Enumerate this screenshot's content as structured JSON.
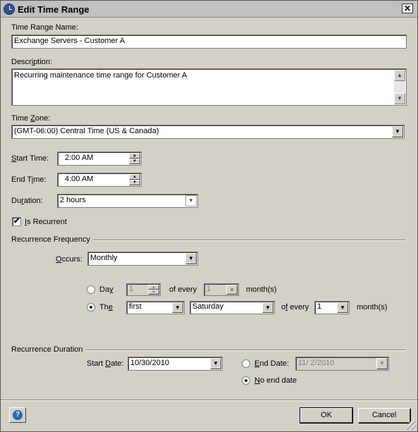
{
  "window": {
    "title": "Edit Time Range"
  },
  "name_field": {
    "label": "Time Range Name:",
    "value": "Exchange Servers - Customer A"
  },
  "description": {
    "label_pre": "Descr",
    "label_u": "i",
    "label_post": "ption:",
    "value": "Recurring maintenance time range for Customer A"
  },
  "timezone": {
    "label_pre": "Time ",
    "label_u": "Z",
    "label_post": "one:",
    "value": "(GMT-06:00) Central Time (US & Canada)"
  },
  "start_time": {
    "label_pre": "",
    "label_u": "S",
    "label_post": "tart Time:",
    "value": "2:00 AM"
  },
  "end_time": {
    "label_pre": "End T",
    "label_u": "i",
    "label_post": "me:",
    "value": "4:00 AM"
  },
  "duration": {
    "label_pre": "Du",
    "label_u": "r",
    "label_post": "ation:",
    "value": "2 hours"
  },
  "recurrent": {
    "label_pre": "",
    "label_u": "I",
    "label_post": "s Recurrent",
    "checked": true,
    "check_glyph": "✔"
  },
  "frequency": {
    "title": "Recurrence Frequency",
    "occurs_label_u": "O",
    "occurs_label_post": "ccurs:",
    "occurs_value": "Monthly",
    "day_label_pre": "Da",
    "day_label_u": "y",
    "day_value": "1",
    "of_every_1": "of every",
    "month_value_1": "1",
    "months_1": "month(s)",
    "the_label_pre": "Th",
    "the_label_u": "e",
    "ordinal_value": "first",
    "weekday_value": "Saturday",
    "of_every_2_pre": "o",
    "of_every_2_u": "f",
    "of_every_2_post": " every",
    "month_value_2": "1",
    "months_2": "month(s)"
  },
  "duration_group": {
    "title": "Recurrence Duration",
    "start_label_pre": "Start ",
    "start_label_u": "D",
    "start_label_post": "ate:",
    "start_value": "10/30/2010",
    "end_label_u": "E",
    "end_label_post": "nd Date:",
    "end_value": "11/  2/2010",
    "no_end_label_u": "N",
    "no_end_label_post": "o end date"
  },
  "buttons": {
    "ok": "OK",
    "cancel": "Cancel",
    "help": "?"
  },
  "icons": {
    "dropdown": "▼",
    "up": "▲",
    "down": "▼",
    "close": "✕"
  }
}
